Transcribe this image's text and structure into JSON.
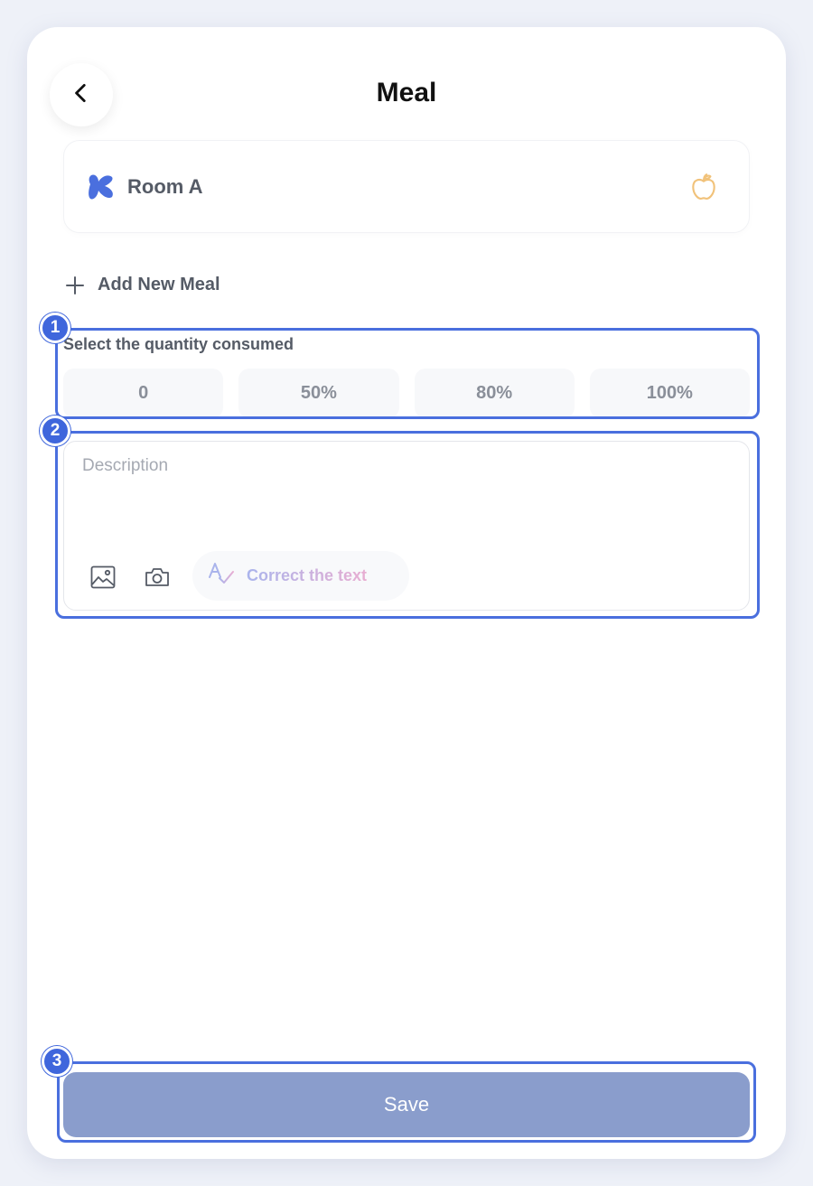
{
  "header": {
    "title": "Meal",
    "back_icon": "chevron-left-icon"
  },
  "room": {
    "name": "Room A",
    "logo_color": "#4a6fde",
    "meal_icon": "apple-icon",
    "meal_icon_color": "#f1c27a"
  },
  "add_meal": {
    "label": "Add New Meal",
    "icon": "plus-icon"
  },
  "quantity": {
    "label": "Select the quantity consumed",
    "options": [
      "0",
      "50%",
      "80%",
      "100%"
    ]
  },
  "description": {
    "placeholder": "Description",
    "value": "",
    "image_icon": "image-icon",
    "camera_icon": "camera-icon",
    "correct_label": "Correct the text",
    "correct_icon": "spellcheck-icon"
  },
  "save": {
    "label": "Save",
    "color": "#8a9dcc"
  },
  "annotations": [
    "1",
    "2",
    "3"
  ]
}
